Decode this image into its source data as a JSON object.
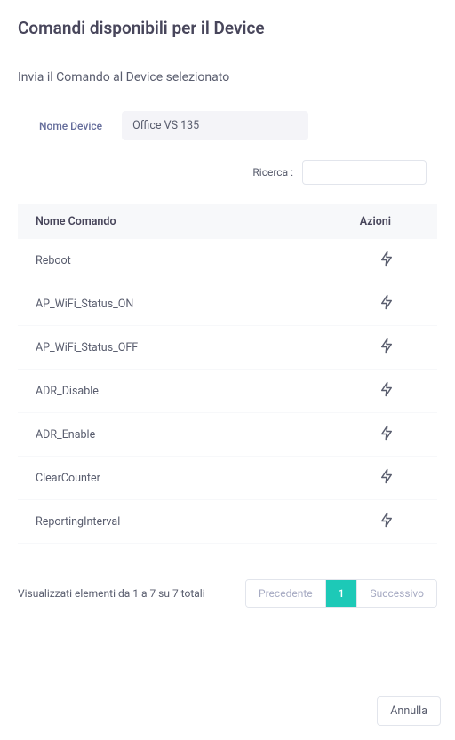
{
  "header": {
    "title": "Comandi disponibili per il Device",
    "subtitle": "Invia il Comando al Device selezionato"
  },
  "device": {
    "label": "Nome Device",
    "value": "Office VS 135"
  },
  "search": {
    "label": "Ricerca :",
    "value": ""
  },
  "table": {
    "columns": {
      "name": "Nome Comando",
      "actions": "Azioni"
    },
    "rows": [
      {
        "name": "Reboot"
      },
      {
        "name": "AP_WiFi_Status_ON"
      },
      {
        "name": "AP_WiFi_Status_OFF"
      },
      {
        "name": "ADR_Disable"
      },
      {
        "name": "ADR_Enable"
      },
      {
        "name": "ClearCounter"
      },
      {
        "name": "ReportingInterval"
      }
    ]
  },
  "pagination": {
    "info": "Visualizzati elementi da 1 a 7 su 7 totali",
    "prev": "Precedente",
    "page": "1",
    "next": "Successivo"
  },
  "footer": {
    "cancel": "Annulla"
  }
}
